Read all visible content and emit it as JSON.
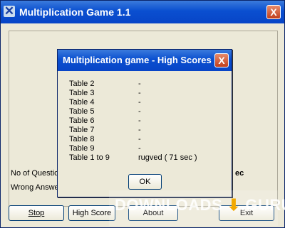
{
  "window": {
    "title": "Multiplication Game 1.1",
    "close_glyph": "X"
  },
  "main": {
    "no_of_questions_label": "No of Question",
    "wrong_answers_label": "Wrong Answe",
    "right_fragment": "ec"
  },
  "buttons": {
    "stop": "Stop",
    "high_score": "High Score",
    "about": "About",
    "exit": "Exit"
  },
  "dialog": {
    "title": "Multiplication game - High Scores",
    "close_glyph": "X",
    "rows": [
      {
        "table": "Table 2",
        "score": "-"
      },
      {
        "table": "Table 3",
        "score": "-"
      },
      {
        "table": "Table 4",
        "score": "-"
      },
      {
        "table": "Table 5",
        "score": "-"
      },
      {
        "table": "Table 6",
        "score": "-"
      },
      {
        "table": "Table 7",
        "score": "-"
      },
      {
        "table": "Table 8",
        "score": "-"
      },
      {
        "table": "Table 9",
        "score": "-"
      },
      {
        "table": "Table 1 to 9",
        "score": "rugved ( 71 sec )"
      }
    ],
    "ok": "OK"
  },
  "watermark": {
    "text": "DOWNLOADS",
    "suffix": ".GURU"
  }
}
